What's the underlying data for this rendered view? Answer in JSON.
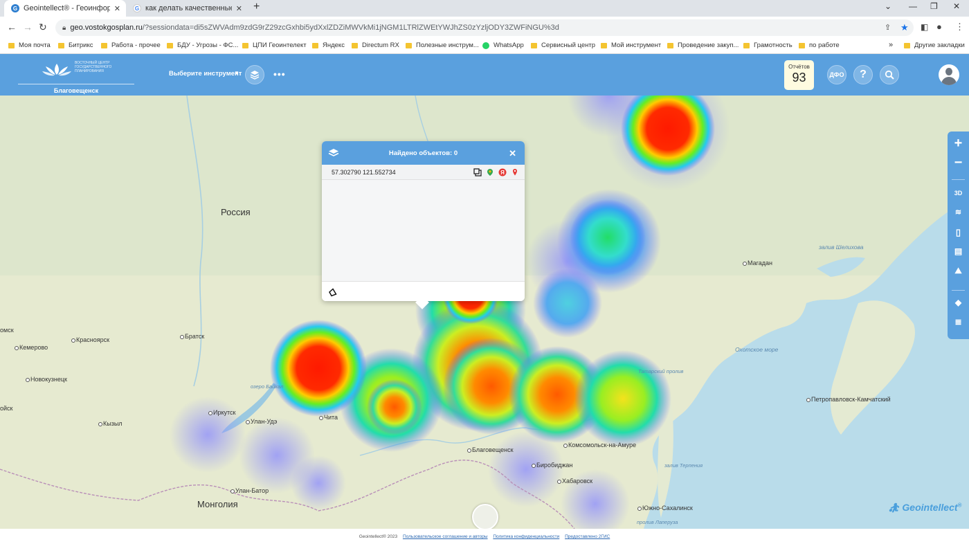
{
  "browser": {
    "tabs": [
      {
        "title": "Geointellect® - Геоинформаци",
        "active": true
      },
      {
        "title": "как делать качественные сним",
        "active": false
      }
    ],
    "url_domain": "geo.vostokgosplan.ru",
    "url_rest": "/?sessiondata=di5sZWVAdm9zdG9rZ29zcGxhbi5ydXxlZDZiMWVkMi1jNGM1LTRlZWEtYWJhZS0zYzljODY3ZWFiNGU%3d",
    "bookmarks": [
      "Моя почта",
      "Битрикс",
      "Работа - прочее",
      "БДУ - Угрозы - ФС...",
      "ЦПИ Геоинтелект",
      "Яндекс",
      "Directum RX",
      "Полезные инструм...",
      "WhatsApp",
      "Сервисный центр",
      "Мой инструмент",
      "Проведение закуп...",
      "Грамотность",
      "по работе"
    ],
    "other_bookmarks": "Другие закладки"
  },
  "header": {
    "logo_text": "ВОСТОЧНЫЙ ЦЕНТР ГОСУДАРСТВЕННОГО ПЛАНИРОВАНИЯ",
    "city": "Благовещенск",
    "tool_select": "Выберите инструмент",
    "reports_label": "Отчётов",
    "reports_count": "93",
    "dfo_label": "ДФО",
    "help_label": "?"
  },
  "popup": {
    "title": "Найдено объектов: 0",
    "coords": "57.302790 121.552734"
  },
  "right_toolbar": {
    "zoom_in": "+",
    "zoom_out": "−",
    "mode_3d": "3D"
  },
  "map_labels": {
    "countries": [
      "Россия",
      "Монголия"
    ],
    "cities": [
      "Магадан",
      "Красноярск",
      "Кемерово",
      "Новокузнецк",
      "Братск",
      "Иркутск",
      "Улан-Удэ",
      "Чита",
      "Кызыл",
      "Благовещенск",
      "Комсомольск-на-Амуре",
      "Биробиджан",
      "Хабаровск",
      "Улан-Батор",
      "Южно-Сахалинск",
      "Петропавловск-Камчатский",
      "омск",
      "ойск"
    ],
    "seas": [
      "Охотское море",
      "залив Шелихова",
      "озеро Байкал",
      "Татарский пролив",
      "залив Терпения",
      "пролив Лаперуза"
    ]
  },
  "brand": "Geointellect",
  "footer": {
    "copyright": "Geointellect® 2023",
    "terms": "Пользовательское соглашение и авторы",
    "privacy": "Политика конфиденциальности",
    "provider": "Предоставлено 2ГИС"
  }
}
